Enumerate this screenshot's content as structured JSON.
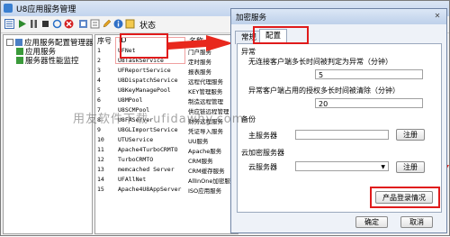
{
  "window": {
    "title": "U8应用服务管理"
  },
  "toolbar": {
    "status_label": "状态"
  },
  "tree": {
    "root": "应用服务配置管理器",
    "items": [
      "应用服务",
      "服务器性能监控"
    ]
  },
  "list": {
    "headers": [
      "序号",
      "ID",
      "名称"
    ],
    "rows": [
      [
        "1",
        "UFNet",
        "门户服务"
      ],
      [
        "2",
        "U8TaskService",
        "定时服务"
      ],
      [
        "3",
        "UFReportService",
        "报表服务"
      ],
      [
        "4",
        "U8DispatchService",
        "远程代理服务"
      ],
      [
        "5",
        "U8KeyManagePool",
        "KEY管理服务"
      ],
      [
        "6",
        "U8MPool",
        "制造远程管理"
      ],
      [
        "7",
        "U8SCMPool",
        "供应链远程管理"
      ],
      [
        "8",
        "U8FAServer",
        "财务远程服务"
      ],
      [
        "9",
        "U8GLImportService",
        "凭证导入服务"
      ],
      [
        "10",
        "UTUService",
        "UU服务"
      ],
      [
        "11",
        "Apache4TurboCRMTO",
        "Apache服务"
      ],
      [
        "12",
        "TurboCRMTO",
        "CRM服务"
      ],
      [
        "13",
        "memcached Server",
        "CRM缓存服务"
      ],
      [
        "14",
        "UFAllNet",
        "AllInOne加密服务"
      ],
      [
        "15",
        "Apache4U8AppServer",
        "ISO应用服务"
      ]
    ]
  },
  "dialog": {
    "title": "加密服务",
    "close_glyph": "✕",
    "tabs": [
      "常规",
      "配置"
    ],
    "section_exception": "异常",
    "label_timeout": "无连接客户端多长时间被判定为异常（分钟）",
    "value_timeout": "5",
    "label_clear": "异常客户端占用的授权多长时间被清除（分钟）",
    "value_clear": "20",
    "section_backup": "备份",
    "label_main_server": "主服务器",
    "register_label": "注册",
    "section_cloud": "云加密服务器",
    "label_cloud_server": "云服务器",
    "register_label2": "注册",
    "product_login_button": "产品登录情况",
    "ok_button": "确定",
    "cancel_button": "取消"
  },
  "watermark": "用友软件下载 ufidawhy.com"
}
